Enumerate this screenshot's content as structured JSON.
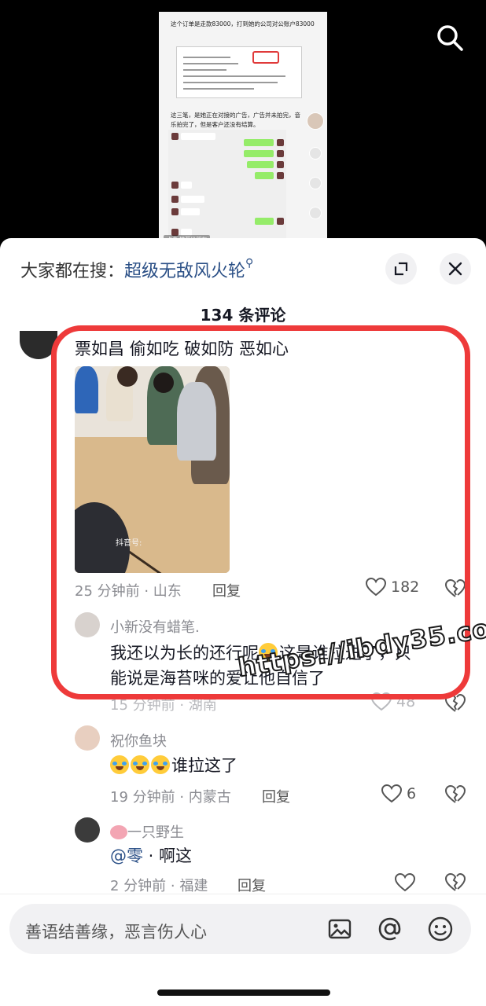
{
  "video": {
    "caption_top": "这个订单是走款83000，打到她的公司对公账户83000",
    "caption_mid": "这三笔，是她正在对接的广告，广告并未拍完，音乐拍完了，但是客户还没有结算。",
    "tag": "点击 推荐给朋友"
  },
  "sheet": {
    "hot_search_prefix": "大家都在搜：",
    "hot_search_keyword": "超级无敌风火轮",
    "comment_count": "134 条评论"
  },
  "comments": [
    {
      "text": "票如昌 偷如吃 破如防 恶如心",
      "image_watermark": "抖音号:",
      "meta": "25 分钟前 · 山东",
      "reply_label": "回复",
      "likes": "182"
    },
    {
      "user": "小新没有蜡笔.",
      "text_line1": "我还以为长的还行呢",
      "text_line1b": "这是谁拉进了，只",
      "text_line2": "能说是海苔咪的爱让他自信了",
      "meta": "15 分钟前 · 湖南",
      "likes": "48"
    },
    {
      "user": "祝你鱼块",
      "text": "谁拉这了",
      "meta": "19 分钟前 · 内蒙古",
      "reply_label": "回复",
      "likes": "6"
    },
    {
      "user": "一只野生",
      "mention": "@零",
      "text": " · 啊这",
      "meta": "2 分钟前 · 福建",
      "reply_label": "回复"
    }
  ],
  "watermark_text": "https://ibdy35.com",
  "input": {
    "placeholder": "善语结善缘，恶言伤人心"
  },
  "icons": {
    "search": "search-icon",
    "expand": "expand-icon",
    "close": "close-icon",
    "like": "heart-icon",
    "dislike": "broken-heart-icon",
    "image": "image-icon",
    "at": "at-icon",
    "emoji": "emoji-icon"
  },
  "colors": {
    "highlight": "#ee3a3a",
    "link": "#2a4f86",
    "muted": "#8a8b91"
  }
}
